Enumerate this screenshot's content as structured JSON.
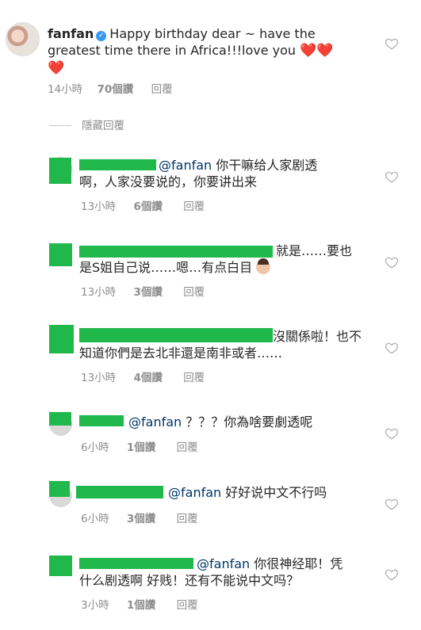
{
  "main_comment": {
    "username": "fanfan",
    "text_line1": "Happy birthday dear ~ have the",
    "text_line2": "greatest time there in Africa!!!love you",
    "emoji": "❤️",
    "time": "14小時",
    "likes": "70個讚",
    "reply": "回覆"
  },
  "hide_replies": "隱藏回覆",
  "replies": [
    {
      "mention": "@fanfan",
      "line1": "你干嘛给人家剧透",
      "line2": "啊，人家没要说的，你要讲出来",
      "time": "13小時",
      "likes": "6個讚",
      "reply": "回覆"
    },
    {
      "line1_tail": "就是……要也",
      "line2": "是S姐自己说……嗯…有点白目",
      "time": "13小時",
      "likes": "3個讚",
      "reply": "回覆"
    },
    {
      "line1_tail": "沒關係啦！也不",
      "line2": "知道你們是去北非還是南非或者……",
      "time": "13小時",
      "likes": "4個讚",
      "reply": "回覆"
    },
    {
      "mention": "@fanfan",
      "line1": "？？？你為啥要劇透呢",
      "time": "6小時",
      "likes": "1個讚",
      "reply": "回覆"
    },
    {
      "mention": "@fanfan",
      "line1": "好好说中文不行吗",
      "time": "6小時",
      "likes": "3個讚",
      "reply": "回覆"
    },
    {
      "mention": "@fanfan",
      "line1": "你很神经耶！凭",
      "line2": "什么剧透啊 好贱！还有不能说中文吗？",
      "time": "3小時",
      "likes": "1個讚",
      "reply": "回覆"
    }
  ],
  "icons": {
    "like": "heart-outline-icon",
    "verified": "verified-badge-icon"
  }
}
